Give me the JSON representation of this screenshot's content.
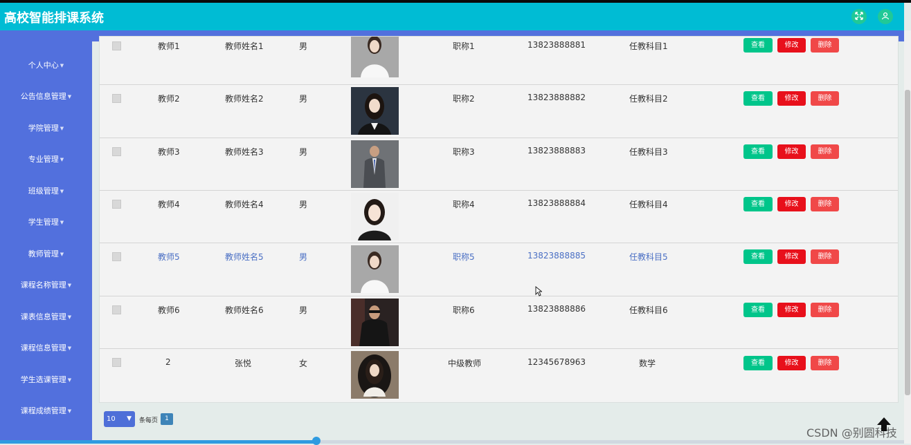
{
  "app": {
    "title": "高校智能排课系统"
  },
  "sidebar": {
    "items": [
      {
        "label": "个人中心"
      },
      {
        "label": "公告信息管理"
      },
      {
        "label": "学院管理"
      },
      {
        "label": "专业管理"
      },
      {
        "label": "班级管理"
      },
      {
        "label": "学生管理"
      },
      {
        "label": "教师管理"
      },
      {
        "label": "课程名称管理"
      },
      {
        "label": "课表信息管理"
      },
      {
        "label": "课程信息管理"
      },
      {
        "label": "学生选课管理"
      },
      {
        "label": "课程成绩管理"
      }
    ]
  },
  "table": {
    "buttons": {
      "view": "查看",
      "edit": "修改",
      "delete": "删除"
    },
    "rows": [
      {
        "account": "教师1",
        "name": "教师姓名1",
        "gender": "男",
        "title": "职称1",
        "phone": "13823888881",
        "subject": "任教科目1"
      },
      {
        "account": "教师2",
        "name": "教师姓名2",
        "gender": "男",
        "title": "职称2",
        "phone": "13823888882",
        "subject": "任教科目2"
      },
      {
        "account": "教师3",
        "name": "教师姓名3",
        "gender": "男",
        "title": "职称3",
        "phone": "13823888883",
        "subject": "任教科目3"
      },
      {
        "account": "教师4",
        "name": "教师姓名4",
        "gender": "男",
        "title": "职称4",
        "phone": "13823888884",
        "subject": "任教科目4"
      },
      {
        "account": "教师5",
        "name": "教师姓名5",
        "gender": "男",
        "title": "职称5",
        "phone": "13823888885",
        "subject": "任教科目5"
      },
      {
        "account": "教师6",
        "name": "教师姓名6",
        "gender": "男",
        "title": "职称6",
        "phone": "13823888886",
        "subject": "任教科目6"
      },
      {
        "account": "2",
        "name": "张悦",
        "gender": "女",
        "title": "中级教师",
        "phone": "12345678963",
        "subject": "数学"
      }
    ]
  },
  "pagination": {
    "page_size": "10",
    "per_page_label": "条每页",
    "current_page": "1"
  },
  "watermark": "CSDN @别圆科技",
  "colors": {
    "header": "#00bcd4",
    "sidebar": "#5270dd",
    "view": "#00c58a",
    "edit": "#e8101b",
    "delete": "#f04848"
  }
}
